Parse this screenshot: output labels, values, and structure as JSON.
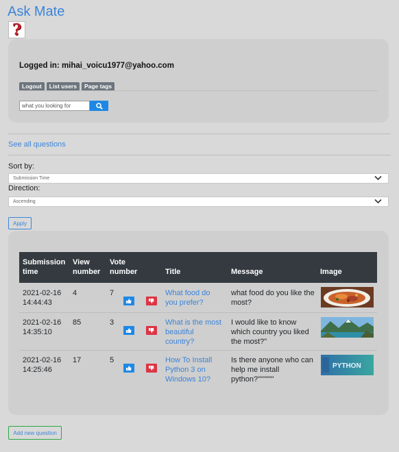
{
  "app": {
    "title": "Ask Mate",
    "logo_glyph": "?"
  },
  "user": {
    "logged_in_text": "Logged in: mihai_voicu1977@yahoo.com",
    "nav": [
      {
        "label": "Logout"
      },
      {
        "label": "List users"
      },
      {
        "label": "Page tags"
      }
    ]
  },
  "search": {
    "placeholder": "what you looking for"
  },
  "links": {
    "see_all": "See all questions"
  },
  "sort": {
    "sort_by_label": "Sort by:",
    "sort_by_value": "Submission Time",
    "direction_label": "Direction:",
    "direction_value": "Ascending",
    "apply_label": "Apply"
  },
  "table": {
    "headers": {
      "submission_time": "Submission time",
      "view_number": "View number",
      "vote_number": "Vote number",
      "title": "Title",
      "message": "Message",
      "image": "Image"
    },
    "rows": [
      {
        "time": "2021-02-16 14:44:43",
        "views": "4",
        "votes": "7",
        "title": "What food do you prefer?",
        "message": "what food do you like the most?",
        "image": "food-photo"
      },
      {
        "time": "2021-02-16 14:35:10",
        "views": "85",
        "votes": "3",
        "title": "What is the most beautiful country?",
        "message": "I would like to know which country you liked the most?\"",
        "image": "landscape-photo"
      },
      {
        "time": "2021-02-16 14:25:46",
        "views": "17",
        "votes": "5",
        "title": "How To Install Python 3 on Windows 10?",
        "message": "Is there anyone who can help me install python?\"\"\"\"\"\"",
        "image": "python-banner",
        "image_text": "PYTHON"
      }
    ]
  },
  "footer": {
    "add_question": "Add new question"
  },
  "colors": {
    "link": "#3b84d9",
    "upvote": "#1e88e5",
    "downvote": "#dc3545",
    "table_header": "#343a40"
  }
}
